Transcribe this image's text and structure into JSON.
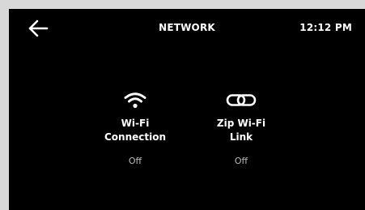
{
  "header": {
    "title": "NETWORK",
    "time": "12:12 PM"
  },
  "options": [
    {
      "label_line1": "Wi-Fi",
      "label_line2": "Connection",
      "status": "Off",
      "icon": "wifi-icon"
    },
    {
      "label_line1": "Zip Wi-Fi",
      "label_line2": "Link",
      "status": "Off",
      "icon": "link-icon"
    }
  ],
  "colors": {
    "background": "#000000",
    "frame": "#d8d8d8",
    "text": "#ffffff",
    "status_text": "#b9b9b9"
  }
}
